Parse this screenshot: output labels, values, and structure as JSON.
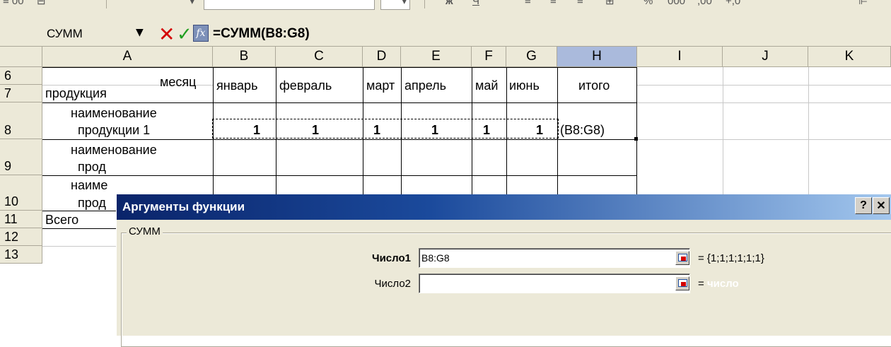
{
  "toolbar": {
    "items": [
      "≡ 00",
      "⊟",
      "▾",
      "▾",
      "ж",
      "Ч",
      "≡",
      "≡",
      "≡",
      "⊞",
      "%",
      "000",
      ",00",
      "+,0",
      "⊫"
    ]
  },
  "formula_bar": {
    "name_box": "СУММ",
    "dropdown": "▼",
    "cancel": "✕",
    "enter": "✓",
    "fx": "fx",
    "formula": "=СУММ(B8:G8)"
  },
  "columns": [
    "A",
    "B",
    "C",
    "D",
    "E",
    "F",
    "G",
    "H",
    "I",
    "J",
    "K"
  ],
  "selected_column": "H",
  "rows": [
    "6",
    "7",
    "8",
    "9",
    "10",
    "11",
    "12",
    "13"
  ],
  "cells": {
    "a6": "месяц",
    "a7": "продукция",
    "b_month": "январь",
    "c_month": "февраль",
    "d_month": "март",
    "e_month": "апрель",
    "f_month": "май",
    "g_month": "июнь",
    "h_total": "итого",
    "a8_line1": "наименование",
    "a8_line2": "продукции 1",
    "b8": "1",
    "c8": "1",
    "d8": "1",
    "e8": "1",
    "f8": "1",
    "g8": "1",
    "h8": "(B8:G8)",
    "a9_line1": "наименование",
    "a9_line2": "прод",
    "a10_line1": "наиме",
    "a10_line2": "прод",
    "a11": "Всего"
  },
  "dialog": {
    "title": "Аргументы функции",
    "help": "?",
    "close": "✕",
    "group_label": "СУММ",
    "arg1_label": "Число1",
    "arg1_value": "B8:G8",
    "arg1_result": "= {1;1;1;1;1;1}",
    "arg2_label": "Число2",
    "arg2_value": "",
    "arg2_result_eq": "=",
    "arg2_result_hint": "число"
  }
}
